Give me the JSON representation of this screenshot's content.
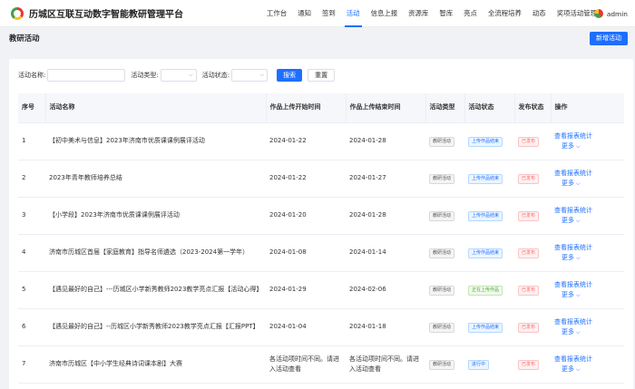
{
  "header": {
    "app_title": "历城区互联互动数字智能教研管理平台",
    "nav": [
      "工作台",
      "通知",
      "签到",
      "活动",
      "信息上报",
      "资源库",
      "智库",
      "亮点",
      "全流程培养",
      "动态",
      "奖项活动管理"
    ],
    "active_nav": "活动",
    "user": "admin",
    "logo_colors": [
      "#e53935",
      "#fbc02d",
      "#43a047"
    ],
    "accent": "#1e6fff"
  },
  "subheader": {
    "title": "教研活动",
    "add_button": "新增活动"
  },
  "filters": {
    "name_label": "活动名称:",
    "type_label": "活动类型:",
    "status_label": "活动状态:",
    "search_button": "搜索",
    "reset_button": "重置"
  },
  "table": {
    "columns": [
      "序号",
      "活动名称",
      "作品上传开始时间",
      "作品上传结束时间",
      "活动类型",
      "活动状态",
      "发布状态",
      "操作"
    ],
    "rows": [
      {
        "no": "1",
        "name": "【初中美术与信息】2023年济南市优质课课例展评活动",
        "start": "2024-01-22",
        "end": "2024-01-28",
        "type": "教研活动",
        "status": "上传作品结束",
        "status_kind": "uploading",
        "publish": "已发布"
      },
      {
        "no": "2",
        "name": "2023年青年教师培养总结",
        "start": "2024-01-22",
        "end": "2024-01-27",
        "type": "教研活动",
        "status": "上传作品结束",
        "status_kind": "uploading",
        "publish": "已发布"
      },
      {
        "no": "3",
        "name": "【小学段】2023年济南市优质课课例展评活动",
        "start": "2024-01-20",
        "end": "2024-01-28",
        "type": "教研活动",
        "status": "上传作品结束",
        "status_kind": "uploading",
        "publish": "已发布"
      },
      {
        "no": "4",
        "name": "济南市历城区首届【家庭教育】指导名师遴选（2023-2024第一学年）",
        "start": "2024-01-08",
        "end": "2024-01-14",
        "type": "教研活动",
        "status": "上传作品结束",
        "status_kind": "uploading",
        "publish": "已发布"
      },
      {
        "no": "5",
        "name": "【遇见最好的自己】---历城区小学新秀教师2023教学亮点汇报【活动心得】",
        "start": "2024-01-29",
        "end": "2024-02-06",
        "type": "教研活动",
        "status": "正在上传作品",
        "status_kind": "uploading-alt",
        "publish": "已发布"
      },
      {
        "no": "6",
        "name": "【遇见最好的自己】--历城区小学新秀教师2023教学亮点汇报【汇报PPT】",
        "start": "2024-01-04",
        "end": "2024-01-18",
        "type": "教研活动",
        "status": "上传作品结束",
        "status_kind": "uploading",
        "publish": "已发布"
      },
      {
        "no": "7",
        "name": "济南市历城区【中小学生经典诗词课本剧】大赛",
        "start": "各活动项时间不同。请进入活动查看",
        "end": "各活动项时间不同。请进入活动查看",
        "type": "教研活动",
        "status": "进行中",
        "status_kind": "inprogress",
        "publish": "已发布"
      }
    ],
    "op_view": "查看报表统计",
    "op_more": "更多"
  }
}
